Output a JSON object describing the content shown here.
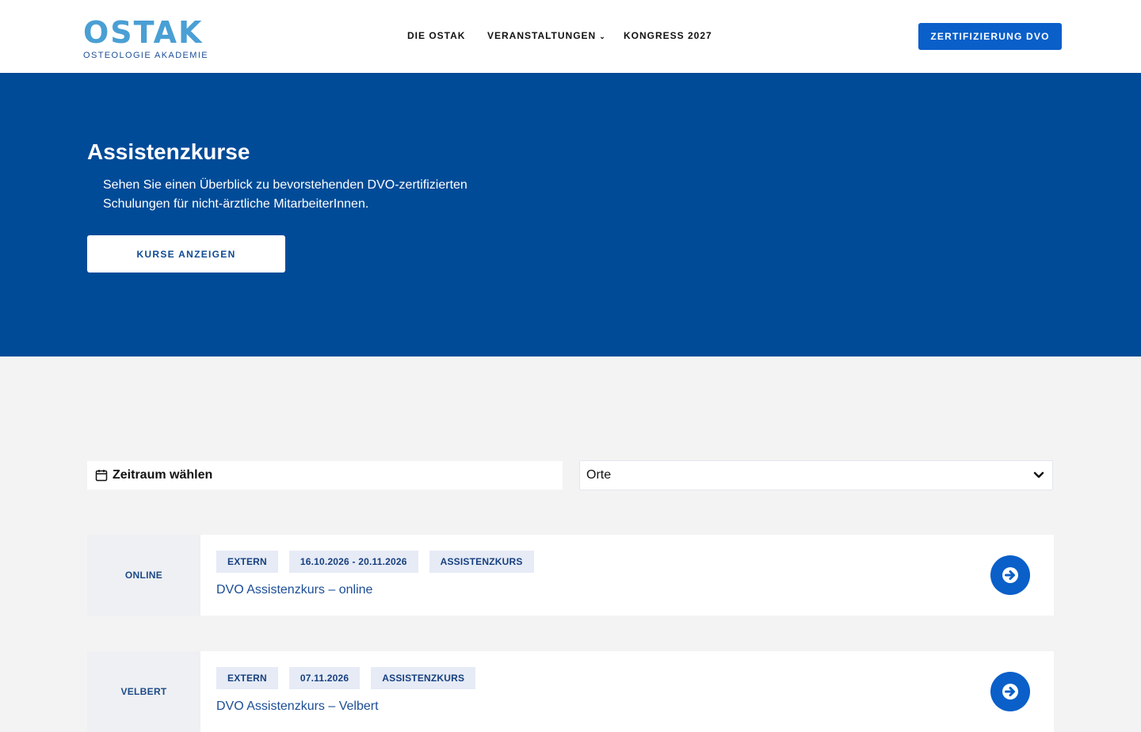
{
  "header": {
    "logo": {
      "word": "OSTAK",
      "subtitle": "OSTEOLOGIE AKADEMIE"
    },
    "nav": [
      {
        "label": "DIE OSTAK"
      },
      {
        "label": "VERANSTALTUNGEN",
        "has_dropdown": true
      },
      {
        "label": "KONGRESS 2027"
      }
    ],
    "cta_label": "ZERTIFIZIERUNG DVO"
  },
  "hero": {
    "title": "Assistenzkurse",
    "text": "Sehen Sie einen Überblick zu bevorstehenden DVO-zertifizierten Schulungen für nicht-ärztliche MitarbeiterInnen.",
    "button_label": "KURSE ANZEIGEN"
  },
  "filters": {
    "date_label": "Zeitraum wählen",
    "location_label": "Orte"
  },
  "courses": [
    {
      "location": "ONLINE",
      "tags": [
        "EXTERN",
        "16.10.2026 - 20.11.2026",
        "ASSISTENZKURS"
      ],
      "title": "DVO Assistenzkurs – online"
    },
    {
      "location": "VELBERT",
      "tags": [
        "EXTERN",
        "07.11.2026",
        "ASSISTENZKURS"
      ],
      "title": "DVO Assistenzkurs – Velbert"
    }
  ],
  "colors": {
    "brand_blue": "#004b98",
    "accent_blue": "#0a5fc9",
    "logo_light": "#4a9fd4",
    "tag_bg": "#e6ebf6",
    "page_bg": "#f3f3f3"
  }
}
